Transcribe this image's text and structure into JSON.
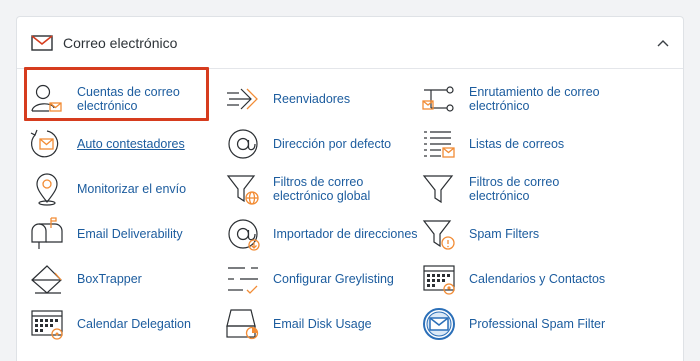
{
  "section": {
    "title": "Correo electrónico",
    "icon": "envelope-icon",
    "toggle_icon": "chevron-up-icon"
  },
  "colors": {
    "link": "#1c5c9e",
    "accent": "#f28c35",
    "highlight": "#d63c1e"
  },
  "items": [
    {
      "label": "Cuentas de correo electrónico",
      "icon": "email-accounts-icon",
      "highlighted": true
    },
    {
      "label": "Reenviadores",
      "icon": "forwarders-icon"
    },
    {
      "label": "Enrutamiento de correo electrónico",
      "icon": "email-routing-icon"
    },
    {
      "label": "Auto contestadores",
      "icon": "autoresponders-icon",
      "underlined": true
    },
    {
      "label": "Dirección por defecto",
      "icon": "default-address-icon"
    },
    {
      "label": "Listas de correos",
      "icon": "mailing-lists-icon"
    },
    {
      "label": "Monitorizar el envío",
      "icon": "track-delivery-icon"
    },
    {
      "label": "Filtros de correo electrónico global",
      "icon": "global-email-filters-icon"
    },
    {
      "label": "Filtros de correo electrónico",
      "icon": "email-filters-icon"
    },
    {
      "label": "Email Deliverability",
      "icon": "mailbox-icon"
    },
    {
      "label": "Importador de direcciones",
      "icon": "address-importer-icon"
    },
    {
      "label": "Spam Filters",
      "icon": "spam-filters-icon"
    },
    {
      "label": "BoxTrapper",
      "icon": "boxtrapper-icon"
    },
    {
      "label": "Configurar Greylisting",
      "icon": "greylisting-icon"
    },
    {
      "label": "Calendarios y Contactos",
      "icon": "calendars-contacts-icon"
    },
    {
      "label": "Calendar Delegation",
      "icon": "calendar-delegation-icon"
    },
    {
      "label": "Email Disk Usage",
      "icon": "email-disk-usage-icon"
    },
    {
      "label": "Professional Spam Filter",
      "icon": "professional-spam-filter-icon"
    }
  ]
}
